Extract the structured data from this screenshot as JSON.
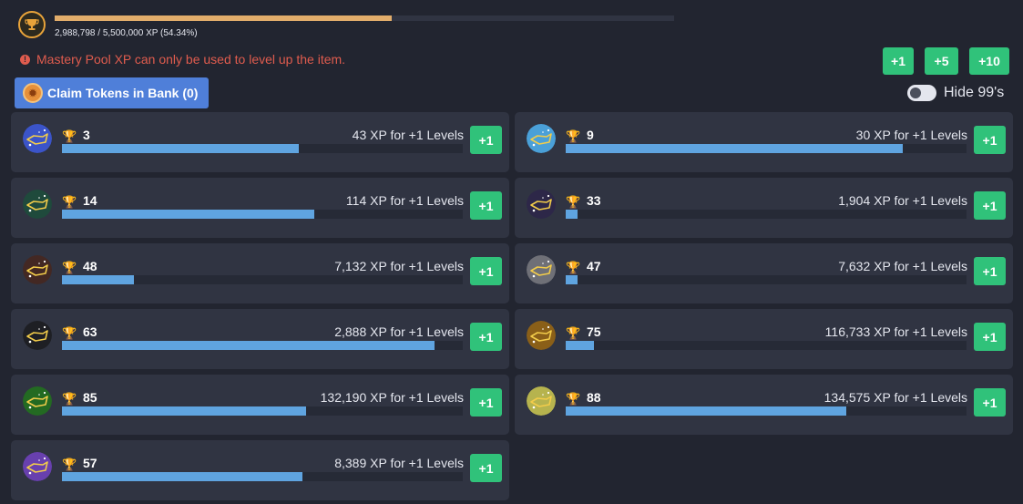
{
  "pool": {
    "xp_text": "2,988,798 / 5,500,000 XP (54.34%)",
    "progress_percent": 54.34,
    "icon": "trophy-icon"
  },
  "warning": {
    "icon": "info-icon",
    "text": "Mastery Pool XP can only be used to level up the item."
  },
  "spend_buttons": [
    "+1",
    "+5",
    "+10"
  ],
  "claim": {
    "label": "Claim Tokens in Bank (0)",
    "icon": "mastery-token-icon"
  },
  "hide99": {
    "label": "Hide 99's",
    "enabled": false
  },
  "items": [
    {
      "level": "3",
      "xp": "43 XP for +1 Levels",
      "progress_percent": 59,
      "color": "#3b54c9",
      "button": "+1",
      "icon": "constellation-icon"
    },
    {
      "level": "9",
      "xp": "30 XP for +1 Levels",
      "progress_percent": 84,
      "color": "#4aa0d8",
      "button": "+1",
      "icon": "constellation-icon"
    },
    {
      "level": "14",
      "xp": "114 XP for +1 Levels",
      "progress_percent": 63,
      "color": "#1f4a3c",
      "button": "+1",
      "icon": "constellation-icon"
    },
    {
      "level": "33",
      "xp": "1,904 XP for +1 Levels",
      "progress_percent": 3,
      "color": "#2d2748",
      "button": "+1",
      "icon": "constellation-icon"
    },
    {
      "level": "48",
      "xp": "7,132 XP for +1 Levels",
      "progress_percent": 18,
      "color": "#432823",
      "button": "+1",
      "icon": "constellation-icon"
    },
    {
      "level": "47",
      "xp": "7,632 XP for +1 Levels",
      "progress_percent": 3,
      "color": "#6f7077",
      "button": "+1",
      "icon": "constellation-icon"
    },
    {
      "level": "63",
      "xp": "2,888 XP for +1 Levels",
      "progress_percent": 93,
      "color": "#1e1f24",
      "button": "+1",
      "icon": "constellation-icon"
    },
    {
      "level": "75",
      "xp": "116,733 XP for +1 Levels",
      "progress_percent": 7,
      "color": "#8a5f18",
      "button": "+1",
      "icon": "constellation-icon"
    },
    {
      "level": "85",
      "xp": "132,190 XP for +1 Levels",
      "progress_percent": 61,
      "color": "#236a22",
      "button": "+1",
      "icon": "constellation-icon"
    },
    {
      "level": "88",
      "xp": "134,575 XP for +1 Levels",
      "progress_percent": 70,
      "color": "#b6b34e",
      "button": "+1",
      "icon": "constellation-icon"
    },
    {
      "level": "57",
      "xp": "8,389 XP for +1 Levels",
      "progress_percent": 60,
      "color": "#6840ae",
      "button": "+1",
      "icon": "constellation-icon"
    }
  ]
}
